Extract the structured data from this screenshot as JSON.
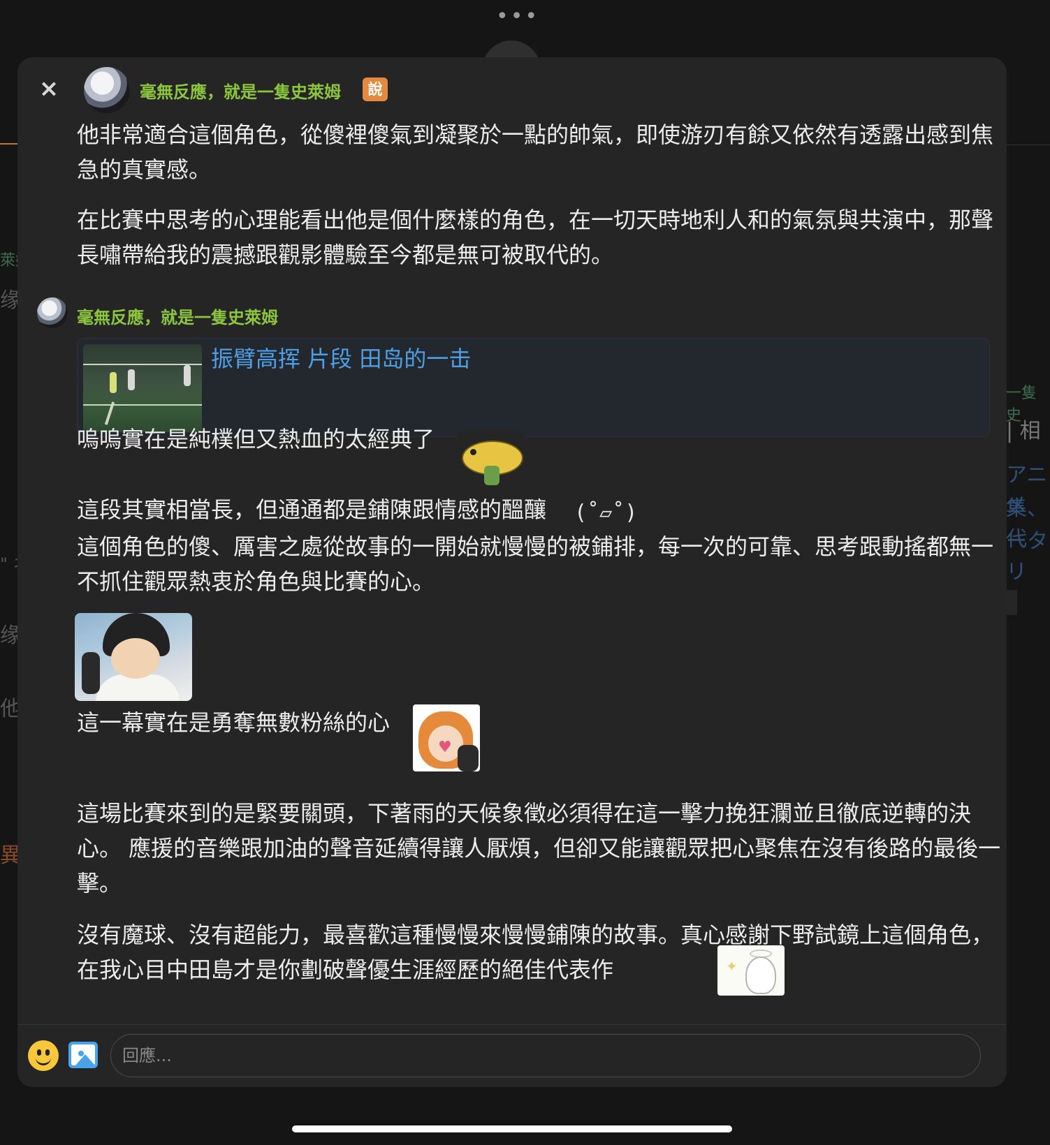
{
  "background": {
    "dots": "•••",
    "fragments": [
      "萊姆",
      "缘要",
      "\"  ネ",
      "缘了",
      "他们",
      "異",
      "一隻史",
      "| 相",
      "アニメ",
      "集、代",
      "ータリ"
    ]
  },
  "modal": {
    "close_icon": "×",
    "author": {
      "name": "毫無反應，就是一隻史萊姆",
      "badge": "說"
    },
    "paragraphs": [
      "他非常適合這個角色，從傻裡傻氣到凝聚於一點的帥氣，即使游刃有餘又依然有透露出感到焦急的真實感。",
      "在比賽中思考的心理能看出他是個什麼樣的角色，在一切天時地利人和的氣氛與共演中，那聲長嘯帶給我的震撼跟觀影體驗至今都是無可被取代的。"
    ],
    "reply": {
      "author": "毫無反應，就是一隻史萊姆",
      "link_title": "振臂高挥 片段 田岛的一击",
      "lines": [
        "嗚嗚實在是純樸但又熱血的太經典了",
        "這段其實相當長，但通通都是鋪陳跟情感的醞釀",
        "這個角色的傻、厲害之處從故事的一開始就慢慢的被鋪排，每一次的可靠、思考跟動搖都無一不抓住觀眾熱衷於角色與比賽的心。",
        "這一幕實在是勇奪無數粉絲的心",
        "這場比賽來到的是緊要關頭，下著雨的天候象徵必須得在這一擊力挽狂瀾並且徹底逆轉的決心。  應援的音樂跟加油的聲音延續得讓人厭煩，但卻又能讓觀眾把心聚焦在沒有後路的最後一擊。",
        "沒有魔球、沒有超能力，最喜歡這種慢慢來慢慢鋪陳的故事。真心感謝下野試鏡上這個角色，在我心目中田島才是你劃破聲優生涯經歷的絕佳代表作"
      ],
      "kaomoji": "(˚▱˚)"
    }
  },
  "composer": {
    "placeholder": "回應..."
  }
}
